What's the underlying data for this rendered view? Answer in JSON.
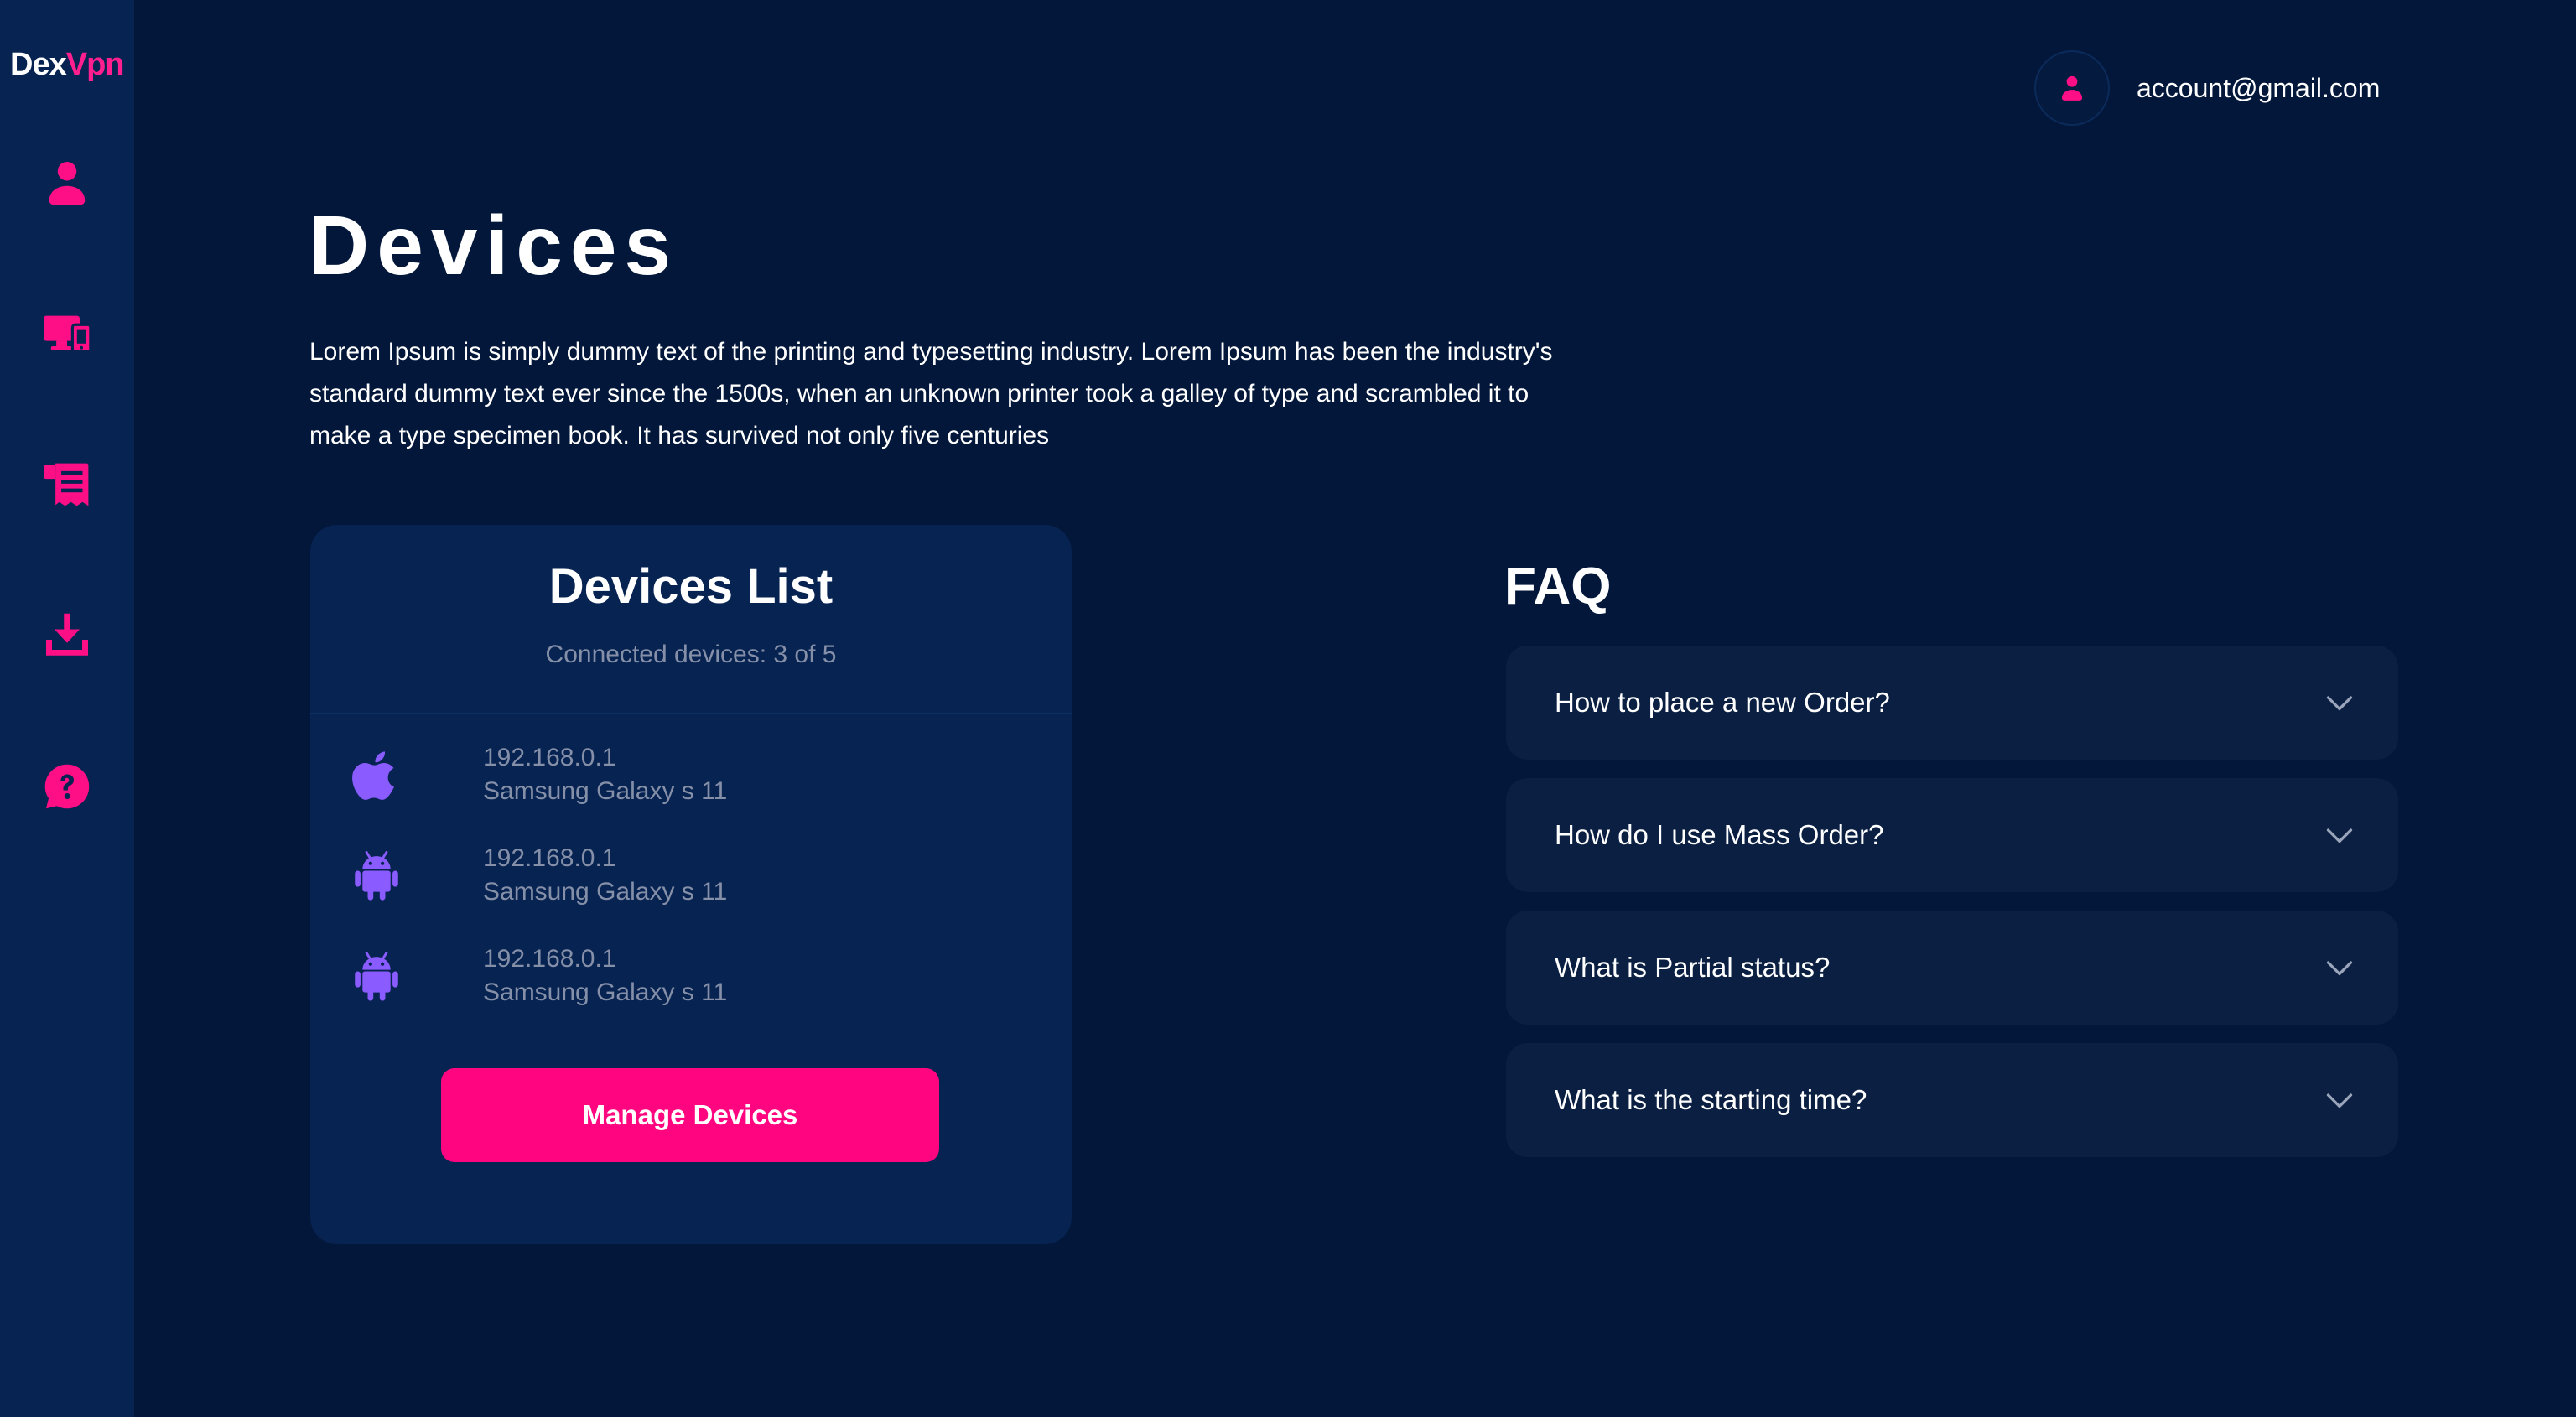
{
  "brand": {
    "part1": "Dex",
    "part2": "Vpn"
  },
  "sidebar": {
    "items": [
      {
        "icon": "user-icon"
      },
      {
        "icon": "devices-icon"
      },
      {
        "icon": "receipt-icon"
      },
      {
        "icon": "download-icon"
      },
      {
        "icon": "help-icon"
      }
    ]
  },
  "account": {
    "email": "account@gmail.com",
    "icon": "user-icon"
  },
  "page": {
    "title": "Devices",
    "description": "Lorem Ipsum is simply dummy text of the printing and typesetting industry. Lorem Ipsum has been the industry's standard dummy text ever since the 1500s, when an unknown printer took a galley of type and scrambled it to make a type specimen book. It has survived not only five centuries"
  },
  "devices": {
    "title": "Devices List",
    "connected_text": "Connected devices: 3 of 5",
    "list": [
      {
        "platform": "apple-icon",
        "ip": "192.168.0.1",
        "name": "Samsung Galaxy s 11"
      },
      {
        "platform": "android-icon",
        "ip": "192.168.0.1",
        "name": "Samsung Galaxy s 11"
      },
      {
        "platform": "android-icon",
        "ip": "192.168.0.1",
        "name": "Samsung Galaxy s 11"
      }
    ],
    "manage_label": "Manage Devices"
  },
  "faq": {
    "title": "FAQ",
    "items": [
      {
        "question": "How to place a new Order?"
      },
      {
        "question": "How do I use Mass Order?"
      },
      {
        "question": "What is Partial status?"
      },
      {
        "question": "What is the starting time?"
      }
    ]
  },
  "colors": {
    "background": "#03173a",
    "sidebar": "#072352",
    "accent": "#ff0580",
    "device_icon": "#8a5cff",
    "muted_text": "#8590a8"
  }
}
